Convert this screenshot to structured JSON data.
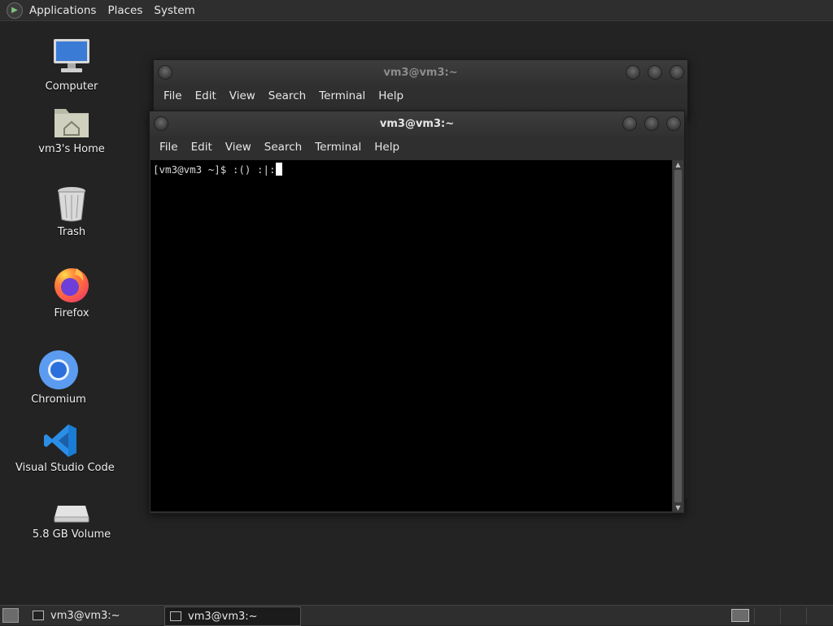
{
  "top_panel": {
    "menus": [
      "Applications",
      "Places",
      "System"
    ]
  },
  "desktop_icons": [
    {
      "label": "Computer",
      "icon": "computer-icon"
    },
    {
      "label": "vm3's Home",
      "icon": "home-folder-icon"
    },
    {
      "label": "Trash",
      "icon": "trash-icon"
    },
    {
      "label": "Firefox",
      "icon": "firefox-icon"
    },
    {
      "label": "Chromium",
      "icon": "chromium-icon"
    },
    {
      "label": "Visual Studio Code",
      "icon": "vscode-icon"
    },
    {
      "label": "5.8 GB Volume",
      "icon": "drive-icon"
    }
  ],
  "back_window": {
    "title": "vm3@vm3:~",
    "menus": [
      "File",
      "Edit",
      "View",
      "Search",
      "Terminal",
      "Help"
    ]
  },
  "front_window": {
    "title": "vm3@vm3:~",
    "menus": [
      "File",
      "Edit",
      "View",
      "Search",
      "Terminal",
      "Help"
    ],
    "terminal": {
      "prompt": "[vm3@vm3 ~]$ ",
      "command": ":() :|:"
    }
  },
  "taskbar": {
    "tasks": [
      {
        "label": "vm3@vm3:~",
        "active": false
      },
      {
        "label": "vm3@vm3:~",
        "active": true
      }
    ]
  },
  "colors": {
    "desktop_bg": "#232323",
    "panel_bg": "#2e2e2e",
    "terminal_bg": "#000000"
  }
}
